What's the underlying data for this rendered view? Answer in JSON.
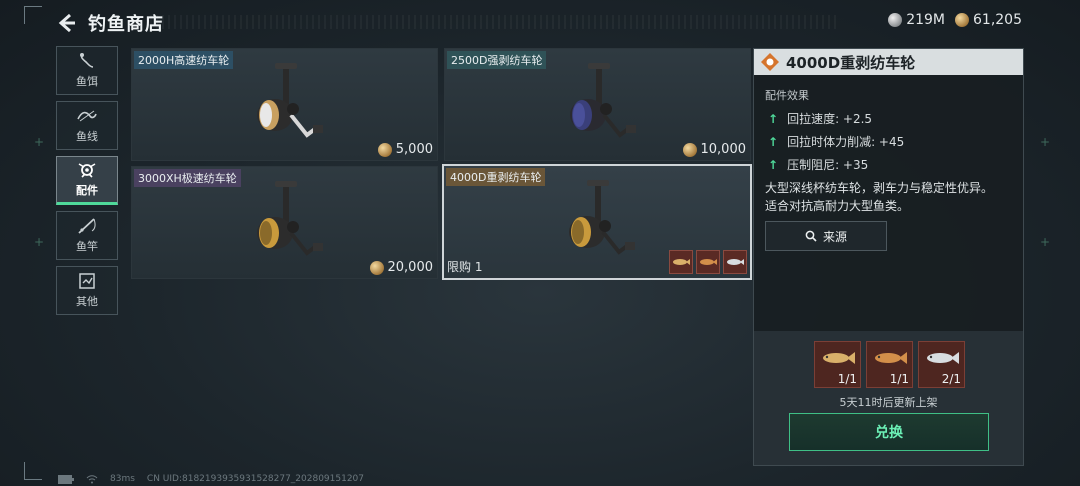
{
  "header": {
    "title": "钓鱼商店"
  },
  "currency": [
    {
      "icon": "silver-coin-icon",
      "value": "219M"
    },
    {
      "icon": "gold-coin-icon",
      "value": "61,205"
    }
  ],
  "sidebar": {
    "items": [
      {
        "label": "鱼饵",
        "icon": "bait-icon",
        "active": false
      },
      {
        "label": "鱼线",
        "icon": "fishing-line-icon",
        "active": false
      },
      {
        "label": "配件",
        "icon": "reel-part-icon",
        "active": true
      },
      {
        "label": "鱼竿",
        "icon": "fishing-rod-icon",
        "active": false
      },
      {
        "label": "其他",
        "icon": "other-icon",
        "active": false
      }
    ]
  },
  "items": [
    {
      "name": "2000H高速纺车轮",
      "price": "5,000",
      "tag_color": "#2d4f64",
      "reel_color": "#c8a060"
    },
    {
      "name": "2500D强剥纺车轮",
      "price": "10,000",
      "tag_color": "#2f5257",
      "reel_color": "#3a3f7a"
    },
    {
      "name": "3000XH极速纺车轮",
      "price": "20,000",
      "tag_color": "#4a4160",
      "reel_color": "#c99a3c"
    },
    {
      "name": "4000D重剥纺车轮",
      "limit": "限购 1",
      "tag_color": "#6a5638",
      "reel_color": "#c99a3c",
      "selected": true
    }
  ],
  "detail": {
    "title": "4000D重剥纺车轮",
    "effects_label": "配件效果",
    "effects": [
      "回拉速度: +2.5",
      "回拉时体力削减: +45",
      "压制阻尼: +35"
    ],
    "description_line1": "大型深线杯纺车轮，剥车力与稳定性优异。",
    "description_line2": "适合对抗高耐力大型鱼类。",
    "source_label": "来源",
    "cost": [
      {
        "count": "1/1",
        "fish": "golden-fish-icon"
      },
      {
        "count": "1/1",
        "fish": "orange-fish-icon"
      },
      {
        "count": "2/1",
        "fish": "silver-fish-icon"
      }
    ],
    "refresh_text": "5天11时后更新上架",
    "exchange_label": "兑换"
  },
  "footer": {
    "ping": "83ms",
    "uid": "CN UID:8182193935931528277_202809151207"
  }
}
